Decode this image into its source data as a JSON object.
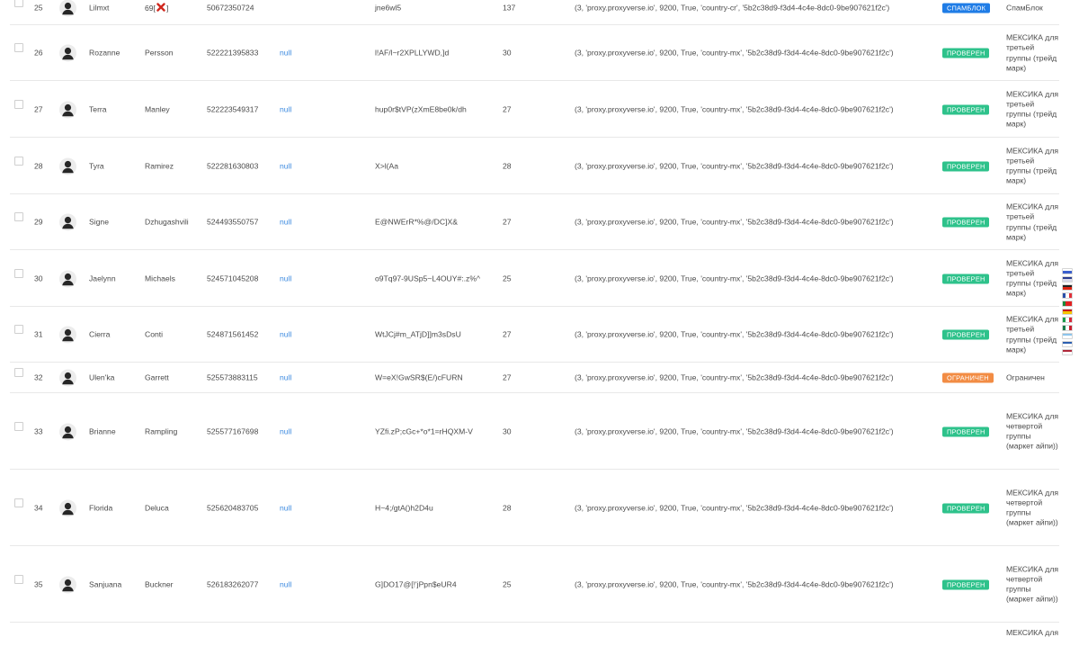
{
  "colors": {
    "badge_spam": "#1f7ce6",
    "badge_checked": "#2ec28b",
    "badge_limited": "#f28c44",
    "link": "#3d8be0"
  },
  "rows": [
    {
      "num": "25",
      "first": "Lilmxt",
      "last_prefix": "69[",
      "last_icon": "x-icon",
      "last_suffix": "]",
      "phone": "50672350724",
      "null_text": "",
      "password": "jne6wl5",
      "age": "137",
      "proxy": "(3, 'proxy.proxyverse.io', 9200, True, 'country-cr', '5b2c38d9-f3d4-4c4e-8dc0-9be907621f2c')",
      "badge": "СПАМБЛОК",
      "badge_type": "spam",
      "status": "СпамБлок"
    },
    {
      "num": "26",
      "first": "Rozanne",
      "last_prefix": "Persson",
      "phone": "522221395833",
      "null_text": "null",
      "password": "l!AF/l~r2XPLLYWD,]d",
      "age": "30",
      "proxy": "(3, 'proxy.proxyverse.io', 9200, True, 'country-mx', '5b2c38d9-f3d4-4c4e-8dc0-9be907621f2c')",
      "badge": "ПРОВЕРЕН",
      "badge_type": "checked",
      "status": "МЕКСИКА для третьей группы (трейд марк)"
    },
    {
      "num": "27",
      "first": "Terra",
      "last_prefix": "Manley",
      "phone": "522223549317",
      "null_text": "null",
      "password": "hup0r$tVP(zXmE8be0k/dh",
      "age": "27",
      "proxy": "(3, 'proxy.proxyverse.io', 9200, True, 'country-mx', '5b2c38d9-f3d4-4c4e-8dc0-9be907621f2c')",
      "badge": "ПРОВЕРЕН",
      "badge_type": "checked",
      "status": "МЕКСИКА для третьей группы (трейд марк)"
    },
    {
      "num": "28",
      "first": "Tyra",
      "last_prefix": "Ramirez",
      "phone": "522281630803",
      "null_text": "null",
      "password": "X>l(Aa",
      "age": "28",
      "proxy": "(3, 'proxy.proxyverse.io', 9200, True, 'country-mx', '5b2c38d9-f3d4-4c4e-8dc0-9be907621f2c')",
      "badge": "ПРОВЕРЕН",
      "badge_type": "checked",
      "status": "МЕКСИКА для третьей группы (трейд марк)"
    },
    {
      "num": "29",
      "first": "Signe",
      "last_prefix": "Dzhugashvili",
      "phone": "524493550757",
      "null_text": "null",
      "password": "E@NWErR*%@/DC]X&",
      "age": "27",
      "proxy": "(3, 'proxy.proxyverse.io', 9200, True, 'country-mx', '5b2c38d9-f3d4-4c4e-8dc0-9be907621f2c')",
      "badge": "ПРОВЕРЕН",
      "badge_type": "checked",
      "status": "МЕКСИКА для третьей группы (трейд марк)"
    },
    {
      "num": "30",
      "first": "Jaelynn",
      "last_prefix": "Michaels",
      "phone": "524571045208",
      "null_text": "null",
      "password": "o9Tq97-9USp5~L4OUY#:.z%^",
      "age": "25",
      "proxy": "(3, 'proxy.proxyverse.io', 9200, True, 'country-mx', '5b2c38d9-f3d4-4c4e-8dc0-9be907621f2c')",
      "badge": "ПРОВЕРЕН",
      "badge_type": "checked",
      "status": "МЕКСИКА для третьей группы (трейд марк)"
    },
    {
      "num": "31",
      "first": "Cierra",
      "last_prefix": "Conti",
      "phone": "524871561452",
      "null_text": "null",
      "password": "WtJCj#m_ATjD]]m3sDsU",
      "age": "27",
      "proxy": "(3, 'proxy.proxyverse.io', 9200, True, 'country-mx', '5b2c38d9-f3d4-4c4e-8dc0-9be907621f2c')",
      "badge": "ПРОВЕРЕН",
      "badge_type": "checked",
      "status": "МЕКСИКА для третьей группы (трейд марк)"
    },
    {
      "num": "32",
      "first": "Ulen'ka",
      "last_prefix": "Garrett",
      "phone": "525573883115",
      "null_text": "null",
      "password": "W=eX!GwSR$(E/)cFURN",
      "age": "27",
      "proxy": "(3, 'proxy.proxyverse.io', 9200, True, 'country-mx', '5b2c38d9-f3d4-4c4e-8dc0-9be907621f2c')",
      "badge": "ОГРАНИЧЕН",
      "badge_type": "limited",
      "status": "Ограничен"
    },
    {
      "num": "33",
      "first": "Brianne",
      "last_prefix": "Rampling",
      "phone": "525577167698",
      "null_text": "null",
      "password": "YZfi.zP;cGc+*o*1=rHQXM-V",
      "age": "30",
      "proxy": "(3, 'proxy.proxyverse.io', 9200, True, 'country-mx', '5b2c38d9-f3d4-4c4e-8dc0-9be907621f2c')",
      "badge": "ПРОВЕРЕН",
      "badge_type": "checked",
      "status": "МЕКСИКА для четвертой группы (маркет айпи))"
    },
    {
      "num": "34",
      "first": "Florida",
      "last_prefix": "Deluca",
      "phone": "525620483705",
      "null_text": "null",
      "password": "H~4;/gtA()h2D4u",
      "age": "28",
      "proxy": "(3, 'proxy.proxyverse.io', 9200, True, 'country-mx', '5b2c38d9-f3d4-4c4e-8dc0-9be907621f2c')",
      "badge": "ПРОВЕРЕН",
      "badge_type": "checked",
      "status": "МЕКСИКА для четвертой группы (маркет айпи))"
    },
    {
      "num": "35",
      "first": "Sanjuana",
      "last_prefix": "Buckner",
      "phone": "526183262077",
      "null_text": "null",
      "password": "G]DO17@[!'jPpn$eUR4",
      "age": "25",
      "proxy": "(3, 'proxy.proxyverse.io', 9200, True, 'country-mx', '5b2c38d9-f3d4-4c4e-8dc0-9be907621f2c')",
      "badge": "ПРОВЕРЕН",
      "badge_type": "checked",
      "status": "МЕКСИКА для четвертой группы (маркет айпи))"
    },
    {
      "num": "",
      "first": "",
      "last_prefix": "",
      "phone": "",
      "null_text": "",
      "password": "",
      "age": "",
      "proxy": "",
      "badge": "",
      "badge_type": "",
      "status": "МЕКСИКА для"
    }
  ],
  "flags": [
    {
      "name": "russia-flag",
      "stripes": [
        "#ffffff",
        "#3a5fcd",
        "#d52b1e"
      ]
    },
    {
      "name": "uk-flag",
      "stripes": [
        "#2a3d8f",
        "#d8d8e8",
        "#2a3d8f"
      ]
    },
    {
      "name": "germany-flag",
      "stripes": [
        "#222222",
        "#dd2211",
        "#f5c400"
      ]
    },
    {
      "name": "france-flag",
      "vertical": [
        "#2a4fa8",
        "#ffffff",
        "#e0303a"
      ]
    },
    {
      "name": "portugal-flag",
      "vertical": [
        "#1a8a3a",
        "#e02020",
        "#e02020"
      ]
    },
    {
      "name": "spain-flag",
      "stripes": [
        "#c61a1a",
        "#f5c400",
        "#c61a1a"
      ]
    },
    {
      "name": "italy-flag",
      "vertical": [
        "#1a9a4a",
        "#ffffff",
        "#d8283a"
      ]
    },
    {
      "name": "mexico-flag",
      "vertical": [
        "#1a7a4a",
        "#ffffff",
        "#c82030"
      ]
    },
    {
      "name": "argentina-flag",
      "stripes": [
        "#8cc4ec",
        "#ffffff",
        "#8cc4ec"
      ]
    },
    {
      "name": "greece-flag",
      "stripes": [
        "#2c5fb0",
        "#ffffff",
        "#2c5fb0"
      ]
    },
    {
      "name": "netherlands-flag",
      "stripes": [
        "#b0283a",
        "#ffffff",
        "#26448c"
      ]
    }
  ]
}
